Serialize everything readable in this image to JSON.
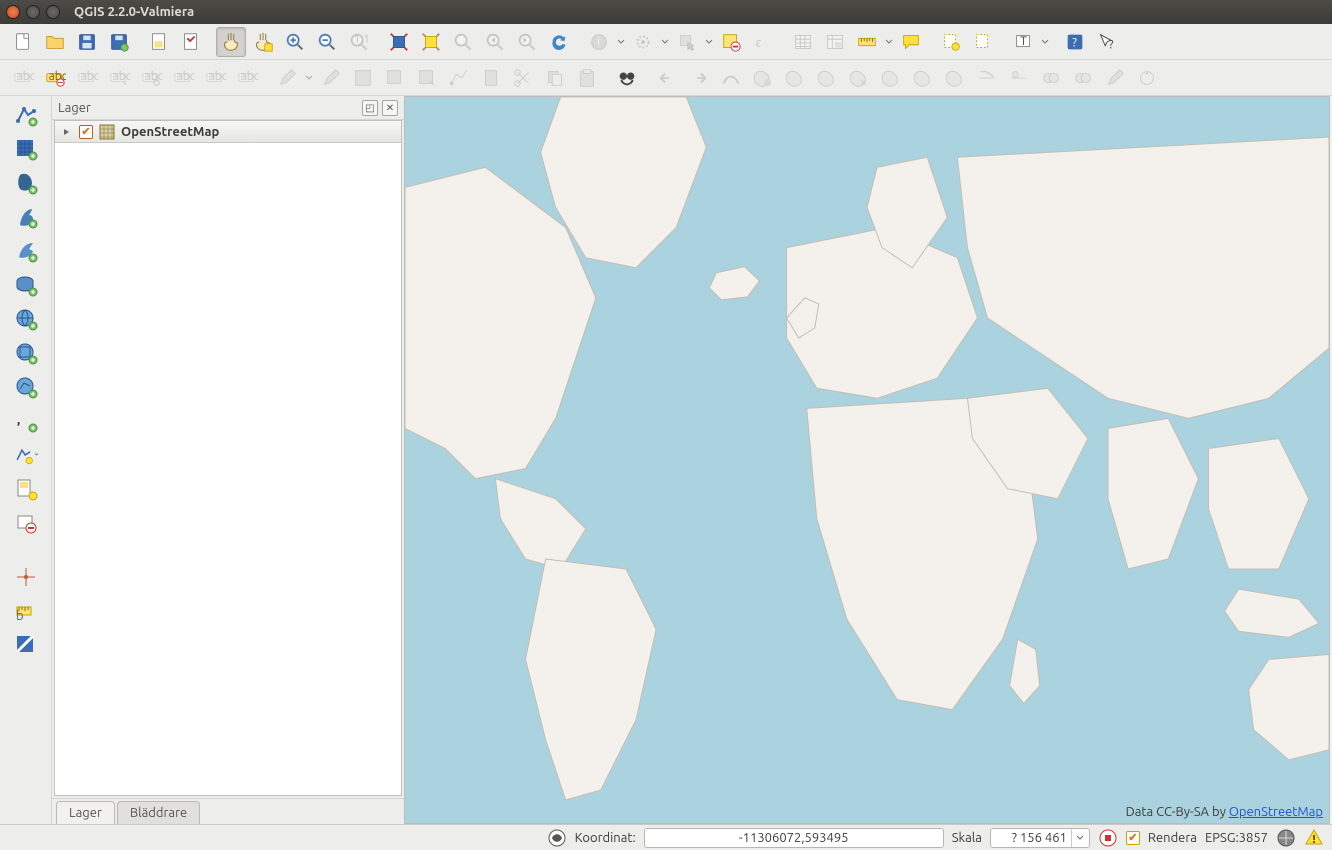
{
  "window": {
    "title": "QGIS 2.2.0-Valmiera"
  },
  "panel": {
    "title": "Lager",
    "layer_name": "OpenStreetMap",
    "tabs": {
      "layers": "Lager",
      "browser": "Bläddrare"
    }
  },
  "statusbar": {
    "coord_label": "Koordinat:",
    "coord_value": "-11306072,593495",
    "scale_label": "Skala",
    "scale_value": "? 156 461",
    "render_label": "Rendera",
    "crs_label": "EPSG:3857"
  },
  "map": {
    "attribution_prefix": "Data CC-By-SA by ",
    "attribution_link": "OpenStreetMap"
  }
}
